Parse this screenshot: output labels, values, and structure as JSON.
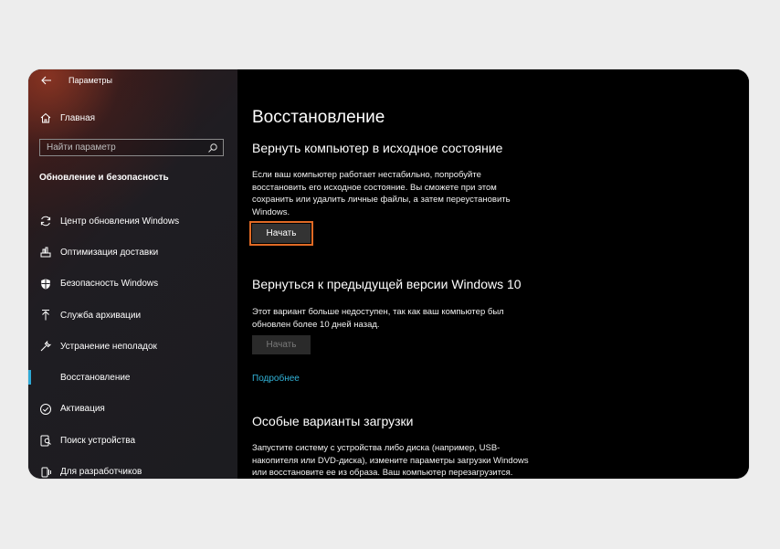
{
  "window": {
    "app_title": "Параметры"
  },
  "sidebar": {
    "home_label": "Главная",
    "search_placeholder": "Найти параметр",
    "section_title": "Обновление и безопасность",
    "items": [
      {
        "label": "Центр обновления Windows",
        "icon": "sync-icon"
      },
      {
        "label": "Оптимизация доставки",
        "icon": "delivery-icon"
      },
      {
        "label": "Безопасность Windows",
        "icon": "shield-icon"
      },
      {
        "label": "Служба архивации",
        "icon": "backup-arrow-icon"
      },
      {
        "label": "Устранение неполадок",
        "icon": "wrench-icon"
      },
      {
        "label": "Восстановление",
        "icon": "recovery-icon",
        "active": true
      },
      {
        "label": "Активация",
        "icon": "check-circle-icon"
      },
      {
        "label": "Поиск устройства",
        "icon": "find-device-icon"
      },
      {
        "label": "Для разработчиков",
        "icon": "developer-icon"
      }
    ]
  },
  "main": {
    "title": "Восстановление",
    "reset": {
      "heading": "Вернуть компьютер в исходное состояние",
      "lines": [
        "Если ваш компьютер работает нестабильно, попробуйте",
        "восстановить его исходное состояние. Вы сможете при этом",
        "сохранить или удалить личные файлы, а затем переустановить",
        "Windows."
      ],
      "button_label": "Начать"
    },
    "rollback": {
      "heading": "Вернуться к предыдущей версии Windows 10",
      "lines": [
        "Этот вариант больше недоступен, так как ваш компьютер был",
        "обновлен более 10 дней назад."
      ],
      "button_label": "Начать"
    },
    "more_link": "Подробнее",
    "advanced": {
      "heading": "Особые варианты загрузки",
      "lines": [
        "Запустите систему с устройства либо диска (например, USB-",
        "накопителя или DVD-диска), измените параметры загрузки Windows",
        "или восстановите ее из образа. Ваш компьютер перезагрузится."
      ]
    }
  },
  "colors": {
    "accent_active": "#2ea9d6",
    "link": "#32b4d9",
    "button_highlight": "#e06a25"
  }
}
